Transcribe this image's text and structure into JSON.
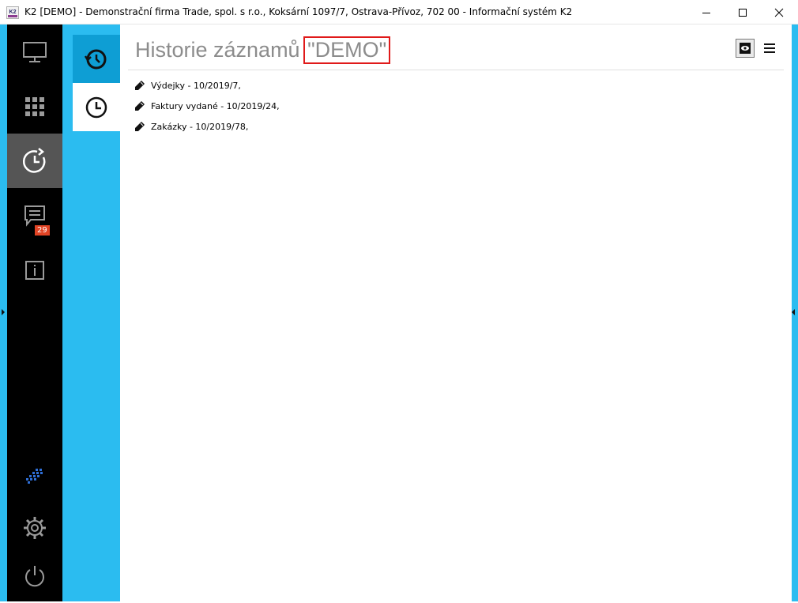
{
  "window": {
    "title": "K2 [DEMO] - Demonstrační firma Trade, spol. s r.o., Koksární 1097/7, Ostrava-Přívoz, 702 00 - Informační systém K2",
    "icon": "k2-app-icon",
    "icon_label": "K2",
    "controls": [
      "minimize-icon",
      "maximize-icon",
      "close-icon"
    ]
  },
  "sidebar": {
    "items": [
      {
        "name": "desktop",
        "icon": "monitor-icon",
        "active": false
      },
      {
        "name": "modules",
        "icon": "grid-icon",
        "active": false
      },
      {
        "name": "history",
        "icon": "history-clock-icon",
        "active": true
      },
      {
        "name": "messages",
        "icon": "chat-icon",
        "badge": "29",
        "active": false
      },
      {
        "name": "info",
        "icon": "info-icon",
        "active": false
      }
    ],
    "bottom": [
      {
        "name": "logo",
        "icon": "k2-logo-icon"
      },
      {
        "name": "settings",
        "icon": "gear-icon"
      },
      {
        "name": "logout",
        "icon": "power-icon"
      }
    ]
  },
  "subnav": {
    "items": [
      {
        "name": "history-records",
        "icon": "history-clock-icon",
        "selected": false
      },
      {
        "name": "recent",
        "icon": "clock-icon",
        "selected": true
      }
    ]
  },
  "main": {
    "title": "Historie záznamů",
    "title_highlight": "\"DEMO\"",
    "header_icons": [
      "view-icon",
      "menu-icon"
    ],
    "records": [
      {
        "icon": "pencil-icon",
        "label": "Výdejky - 10/2019/7,"
      },
      {
        "icon": "pencil-icon",
        "label": "Faktury vydané - 10/2019/24,"
      },
      {
        "icon": "pencil-icon",
        "label": "Zakázky - 10/2019/78,"
      }
    ]
  },
  "colors": {
    "accent_blue": "#2bbcf0",
    "active_blue": "#0e9ed4",
    "sidebar_bg": "#000000",
    "sidebar_active": "#555555",
    "badge_red": "#e24425",
    "highlight_red": "#e01a1a"
  }
}
